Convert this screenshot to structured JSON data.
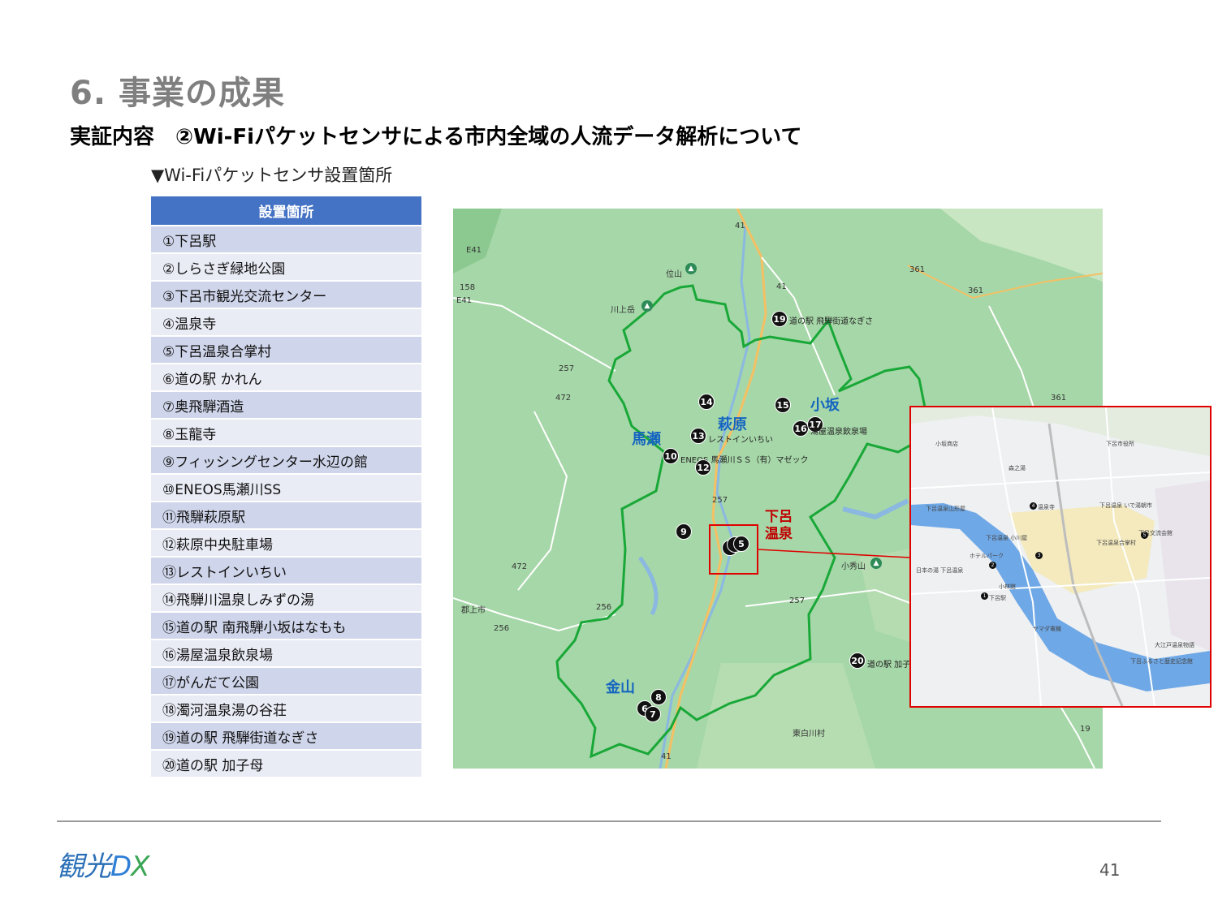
{
  "section_title": "6. 事業の成果",
  "subtitle": "実証内容　②Wi-Fiパケットセンサによる市内全域の人流データ解析について",
  "caption": "▼Wi-Fiパケットセンサ設置箇所",
  "table": {
    "header": "設置箇所",
    "rows": [
      "①下呂駅",
      "②しらさぎ緑地公園",
      "③下呂市観光交流センター",
      "④温泉寺",
      "⑤下呂温泉合掌村",
      "⑥道の駅 かれん",
      "⑦奥飛騨酒造",
      "⑧玉龍寺",
      "⑨フィッシングセンター水辺の館",
      "⑩ENEOS馬瀬川SS",
      "⑪飛騨萩原駅",
      "⑫萩原中央駐車場",
      "⑬レストインいちい",
      "⑭飛騨川温泉しみずの湯",
      "⑮道の駅 南飛騨小坂はなもも",
      "⑯湯屋温泉飲泉場",
      "⑰がんだて公園",
      "⑱濁河温泉湯の谷荘",
      "⑲道の駅 飛騨街道なぎさ",
      "⑳道の駅 加子母"
    ]
  },
  "map": {
    "areas": {
      "maze": "馬瀬",
      "hagiwara": "萩原",
      "osaka": "小坂",
      "kanayama": "金山",
      "gero_onsen_1": "下呂",
      "gero_onsen_2": "温泉"
    },
    "markers": [
      "19",
      "14",
      "15",
      "16",
      "17",
      "13",
      "10",
      "12",
      "9",
      "5",
      "8",
      "6",
      "7",
      "20"
    ],
    "marker_labels": {
      "m19": "道の駅 飛騨街道なぎさ",
      "m16": "湯屋温泉飲泉場",
      "m13": "レストインいちい",
      "m10": "ENEOS 馬瀬川ＳＳ（有）マゼック",
      "m20": "道の駅 加子"
    },
    "places": {
      "iyama": "位山",
      "kawauedake": "川上岳",
      "kohideyama": "小秀山",
      "gujo": "郡上市",
      "higashishirakawa": "東白川村"
    },
    "road_numbers": [
      "41",
      "41",
      "361",
      "361",
      "361",
      "158",
      "257",
      "472",
      "472",
      "257",
      "256",
      "256",
      "257",
      "41",
      "19"
    ],
    "road_signs": [
      "E41",
      "E41"
    ],
    "colors": {
      "boundary": "#19a838",
      "highlight_box": "#e00000",
      "marker": "#111111"
    }
  },
  "inset": {
    "labels": [
      "下呂温泉山形屋",
      "温泉寺",
      "下呂温泉 いで湯朝市",
      "下呂温泉合掌村",
      "下呂交流会館",
      "下呂駅",
      "ホテルパーク",
      "小林館",
      "日本の湯 下呂温泉",
      "ヤマダ電機",
      "下呂市役所",
      "森之湯",
      "小坂商店",
      "下呂温泉 小川屋",
      "大江戸温泉物語",
      "下呂ふるさと歴史記念館"
    ],
    "markers": [
      "4",
      "5",
      "2",
      "3",
      "1"
    ]
  },
  "footer": {
    "logo_kan": "観光",
    "logo_d": "D",
    "logo_x": "X",
    "page": "41"
  }
}
